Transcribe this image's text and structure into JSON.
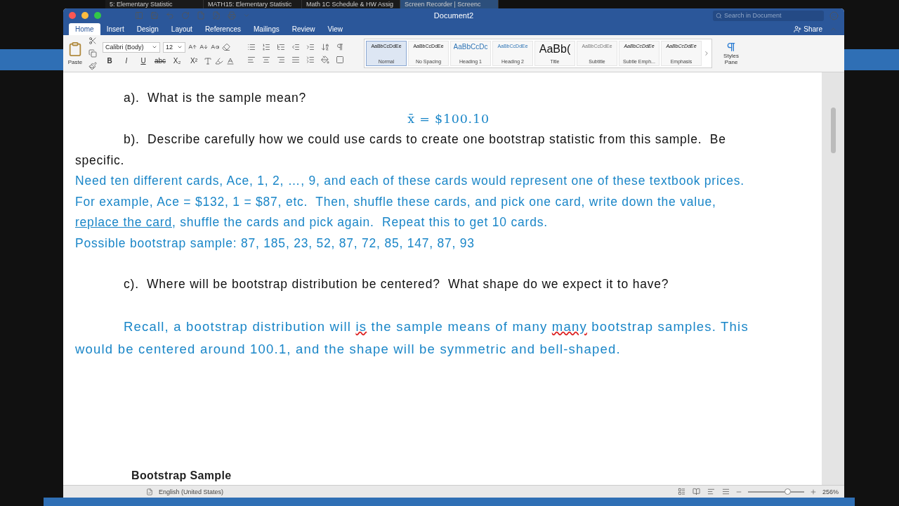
{
  "browser_tabs": [
    {
      "title": "5: Elementary Statistic",
      "selected": false
    },
    {
      "title": "MATH15: Elementary Statistic",
      "selected": false
    },
    {
      "title": "Math 1C Schedule & HW Assig",
      "selected": false
    },
    {
      "title": "Screen Recorder | Screenc",
      "selected": true
    }
  ],
  "window": {
    "title": "Document2",
    "search_placeholder": "Search in Document",
    "share": "Share"
  },
  "ribbon_tabs": [
    {
      "label": "Home",
      "selected": true
    },
    {
      "label": "Insert",
      "selected": false
    },
    {
      "label": "Design",
      "selected": false
    },
    {
      "label": "Layout",
      "selected": false
    },
    {
      "label": "References",
      "selected": false
    },
    {
      "label": "Mailings",
      "selected": false
    },
    {
      "label": "Review",
      "selected": false
    },
    {
      "label": "View",
      "selected": false
    }
  ],
  "paste_label": "Paste",
  "font": {
    "name": "Calibri (Body)",
    "size": "12"
  },
  "format_buttons": [
    {
      "label": "B",
      "kind": "bold"
    },
    {
      "label": "I",
      "kind": "italic"
    },
    {
      "label": "U",
      "kind": "underline"
    },
    {
      "label": "abc",
      "kind": "strike"
    },
    {
      "label": "X₂",
      "kind": "plain"
    },
    {
      "label": "X²",
      "kind": "plain"
    }
  ],
  "styles": [
    {
      "preview": "AaBbCcDdEe",
      "label": "Normal",
      "kind": "normal",
      "selected": true
    },
    {
      "preview": "AaBbCcDdEe",
      "label": "No Spacing",
      "kind": "normal",
      "selected": false
    },
    {
      "preview": "AaBbCcDc",
      "label": "Heading 1",
      "kind": "heading1",
      "selected": false
    },
    {
      "preview": "AaBbCcDdEe",
      "label": "Heading 2",
      "kind": "heading2",
      "selected": false
    },
    {
      "preview": "AaBb(",
      "label": "Title",
      "kind": "title",
      "selected": false
    },
    {
      "preview": "AaBbCcDdEe",
      "label": "Subtitle",
      "kind": "subtitle",
      "selected": false
    },
    {
      "preview": "AaBbCcDdEe",
      "label": "Subtle Emph...",
      "kind": "italic",
      "selected": false
    },
    {
      "preview": "AaBbCcDdEe",
      "label": "Emphasis",
      "kind": "italic",
      "selected": false
    }
  ],
  "styles_pane": "Styles Pane",
  "document_lines": [
    {
      "kind": "question",
      "indent": true,
      "gap_before": false,
      "segments": [
        {
          "text": "a).  What is the sample mean?",
          "kind": "plain"
        }
      ]
    },
    {
      "kind": "formula",
      "indent": false,
      "gap_before": false,
      "segments": [
        {
          "text": "x̄ = $100.10",
          "kind": "plain"
        }
      ]
    },
    {
      "kind": "question",
      "indent": true,
      "gap_before": false,
      "segments": [
        {
          "text": "b).  Describe carefully how we could use cards to create one bootstrap statistic from this sample.  Be",
          "kind": "plain"
        }
      ]
    },
    {
      "kind": "question",
      "indent": false,
      "gap_before": false,
      "segments": [
        {
          "text": "specific.",
          "kind": "plain"
        }
      ]
    },
    {
      "kind": "answer",
      "indent": false,
      "gap_before": false,
      "segments": [
        {
          "text": "Need ten different cards, Ace, 1, 2, …, 9, and each of these cards would represent one of these textbook prices.",
          "kind": "plain"
        }
      ]
    },
    {
      "kind": "answer",
      "indent": false,
      "gap_before": false,
      "segments": [
        {
          "text": "For example, Ace = $132, 1 = $87, etc.  Then, shuffle these cards, and pick one card, write down the value,",
          "kind": "plain"
        }
      ]
    },
    {
      "kind": "answer",
      "indent": false,
      "gap_before": false,
      "segments": [
        {
          "text": "replace the card",
          "kind": "underlined"
        },
        {
          "text": ", shuffle the cards and pick again.  Repeat this to get 10 cards.",
          "kind": "plain"
        }
      ]
    },
    {
      "kind": "answer",
      "indent": false,
      "gap_before": false,
      "segments": [
        {
          "text": "Possible bootstrap sample: 87, 185, 23, 52, 87, 72, 85, 147, 87, 93",
          "kind": "plain"
        }
      ]
    },
    {
      "kind": "question",
      "indent": true,
      "gap_before": true,
      "segments": [
        {
          "text": "c).  Where will be bootstrap distribution be centered?  What shape do we expect it to have?",
          "kind": "plain"
        }
      ]
    },
    {
      "kind": "answer",
      "indent": true,
      "gap_before": true,
      "segments": [
        {
          "text": "Recall, a bootstrap distribution will ",
          "kind": "plain"
        },
        {
          "text": "is",
          "kind": "misspelled"
        },
        {
          "text": " the sample means of many ",
          "kind": "plain"
        },
        {
          "text": "many",
          "kind": "misspelled"
        },
        {
          "text": " bootstrap samples. This",
          "kind": "plain"
        }
      ]
    },
    {
      "kind": "answer",
      "indent": false,
      "gap_before": false,
      "segments": [
        {
          "text": "would be centered around 100.1, and the shape will be symmetric and bell-shaped.",
          "kind": "plain"
        }
      ]
    }
  ],
  "bottom_heading": "Bootstrap Sample",
  "status_bar": {
    "language": "English (United States)",
    "zoom": "256%",
    "level": 0.7
  }
}
